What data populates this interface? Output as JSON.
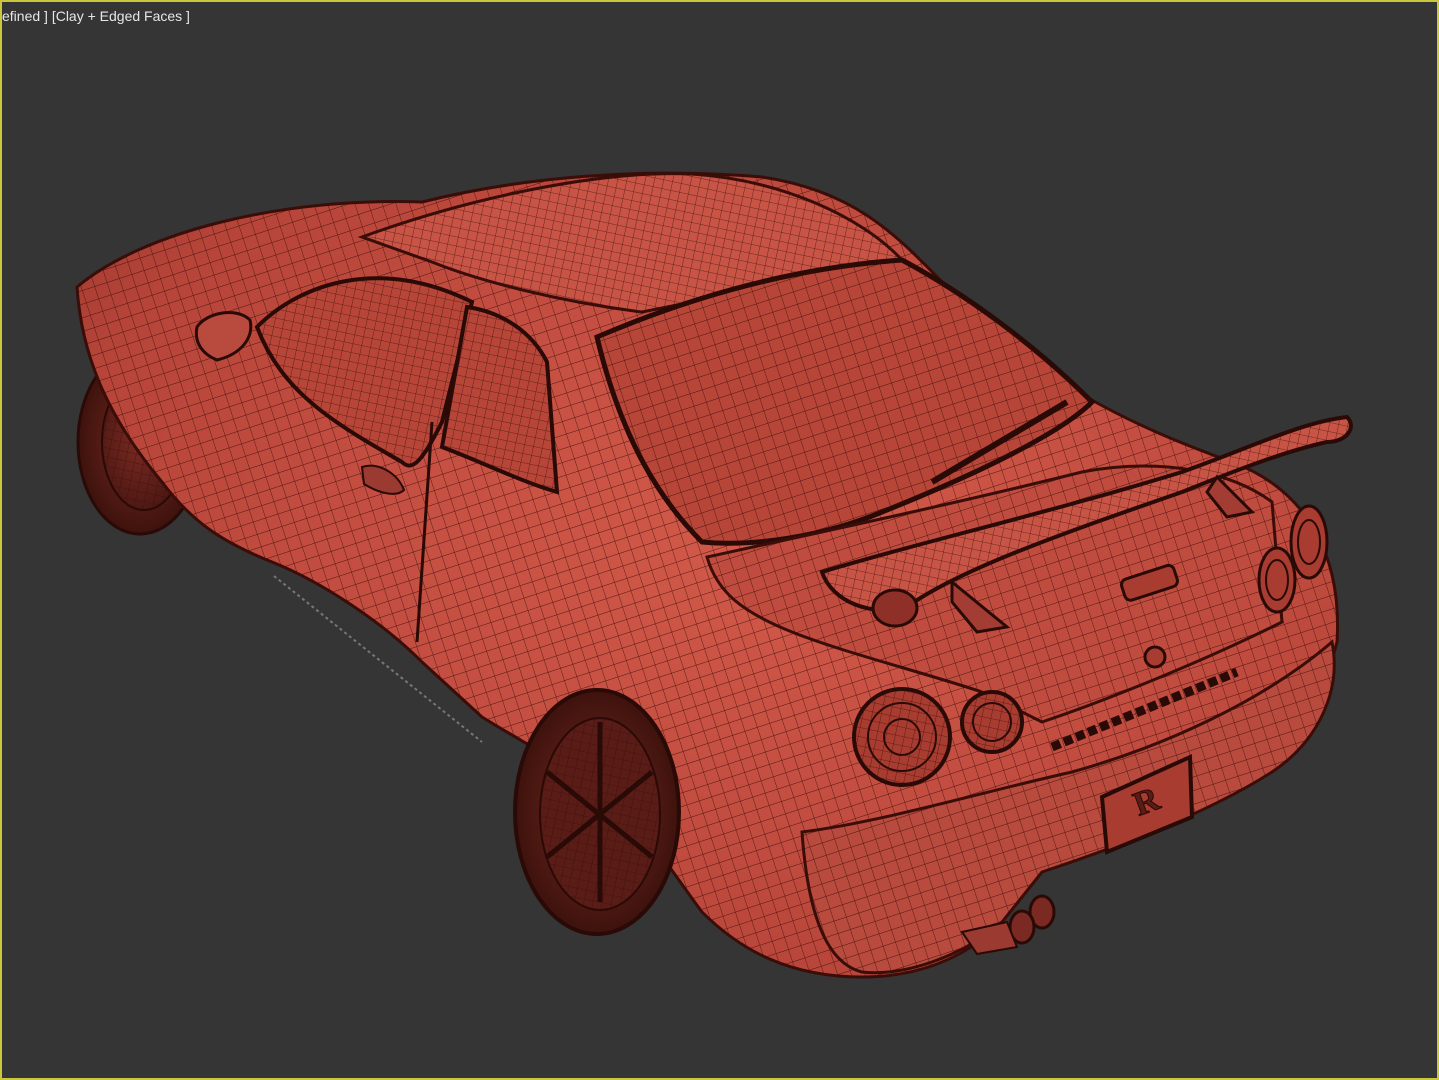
{
  "viewport": {
    "label": "efined ] [Clay + Edged Faces ]",
    "border_color": "#c8c83a",
    "background_color": "#353535",
    "model_color": "#c0463a",
    "wire_color": "#3a0d08",
    "badge_text": "R"
  }
}
